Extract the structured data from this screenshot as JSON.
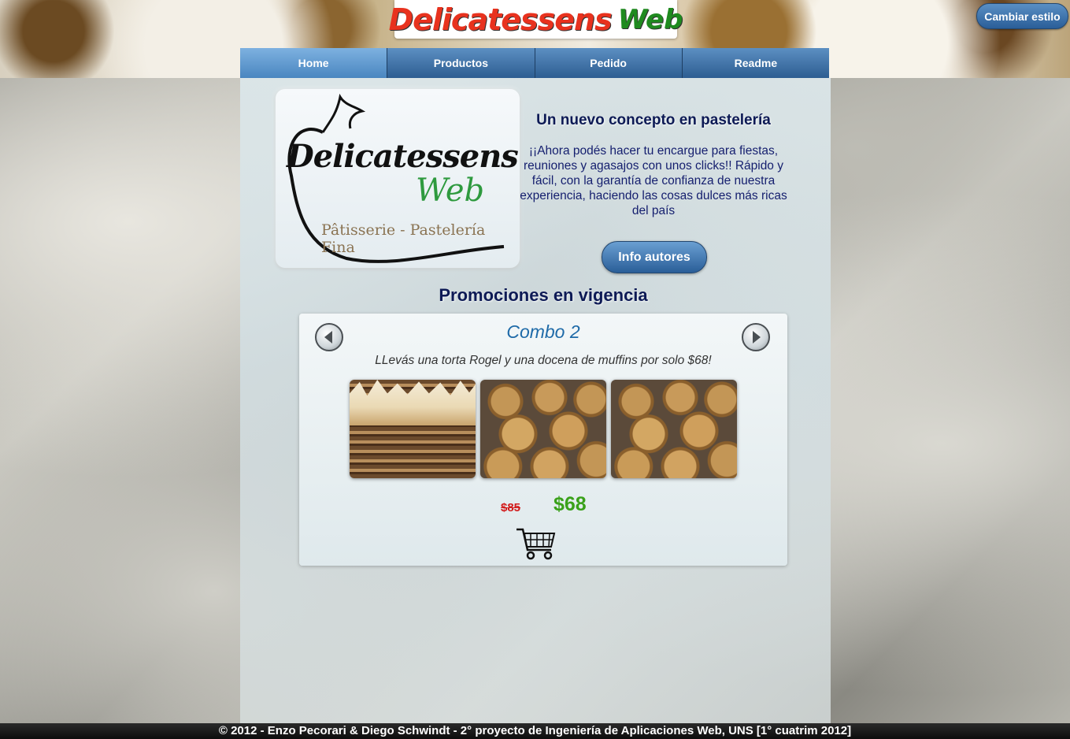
{
  "header": {
    "logo_word1": "Delicatessens",
    "logo_word2": "Web",
    "style_button": "Cambiar estilo"
  },
  "nav": {
    "items": [
      {
        "label": "Home"
      },
      {
        "label": "Productos"
      },
      {
        "label": "Pedido"
      },
      {
        "label": "Readme"
      }
    ]
  },
  "logo_card": {
    "name": "Delicatessens",
    "web": "Web",
    "subtitle": "Pâtisserie - Pastelería Fina"
  },
  "intro": {
    "title": "Un nuevo concepto en pastelería",
    "text": "¡¡Ahora podés hacer tu encargue para fiestas, reuniones y agasajos con unos clicks!! Rápido y fácil, con la garantía de confianza de nuestra experiencia, haciendo las cosas dulces más ricas del país",
    "info_button": "Info autores"
  },
  "promo": {
    "section_title": "Promociones en vigencia",
    "combo_title": "Combo 2",
    "description": "LLevás una torta Rogel y una docena de muffins por solo $68!",
    "old_price": "$85",
    "new_price": "$68"
  },
  "footer": {
    "text": "© 2012 - Enzo Pecorari & Diego Schwindt - 2° proyecto de Ingeniería de Aplicaciones Web, UNS [1° cuatrim 2012]"
  },
  "colors": {
    "nav_blue": "#2d5d91",
    "title_navy": "#0d1a55",
    "price_green": "#3aa11a",
    "price_red": "#d21b1b"
  }
}
